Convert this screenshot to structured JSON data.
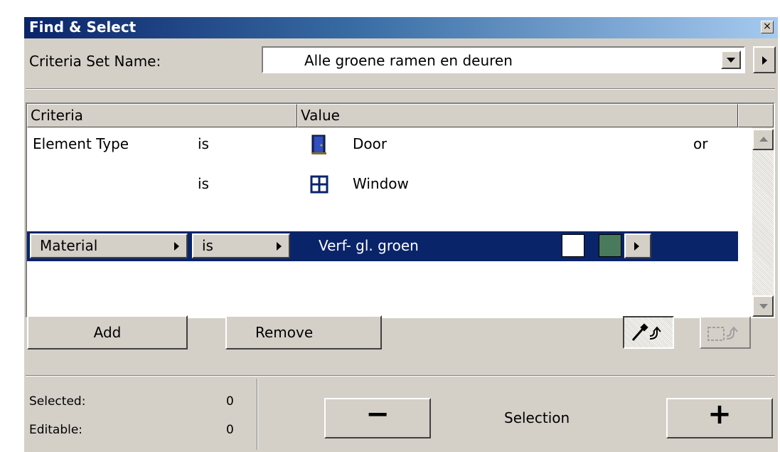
{
  "window": {
    "title": "Find & Select",
    "close_glyph": "×"
  },
  "criteria_set": {
    "label": "Criteria Set Name:",
    "value": "Alle groene ramen en deuren"
  },
  "list": {
    "headers": {
      "criteria": "Criteria",
      "value": "Value"
    },
    "rows": [
      {
        "criteria": "Element Type",
        "op": "is",
        "icon": "door-icon",
        "value": "Door",
        "logic": "or"
      },
      {
        "criteria": "",
        "op": "is",
        "icon": "window-icon",
        "value": "Window",
        "logic": ""
      },
      {
        "criteria": "Material",
        "op": "is",
        "value": "Verf- gl. groen",
        "swatch_colors": [
          "#ffffff",
          "#4a7a5c"
        ]
      }
    ]
  },
  "buttons": {
    "add": "Add",
    "remove": "Remove",
    "minus": "−",
    "plus": "+",
    "selection_label": "Selection"
  },
  "status": {
    "selected_label": "Selected:",
    "selected_value": "0",
    "editable_label": "Editable:",
    "editable_value": "0"
  },
  "colors": {
    "face": "#d4d0c8",
    "selection_highlight": "#0a246a",
    "title_gradient_start": "#0a246a",
    "title_gradient_end": "#a6caf0"
  }
}
